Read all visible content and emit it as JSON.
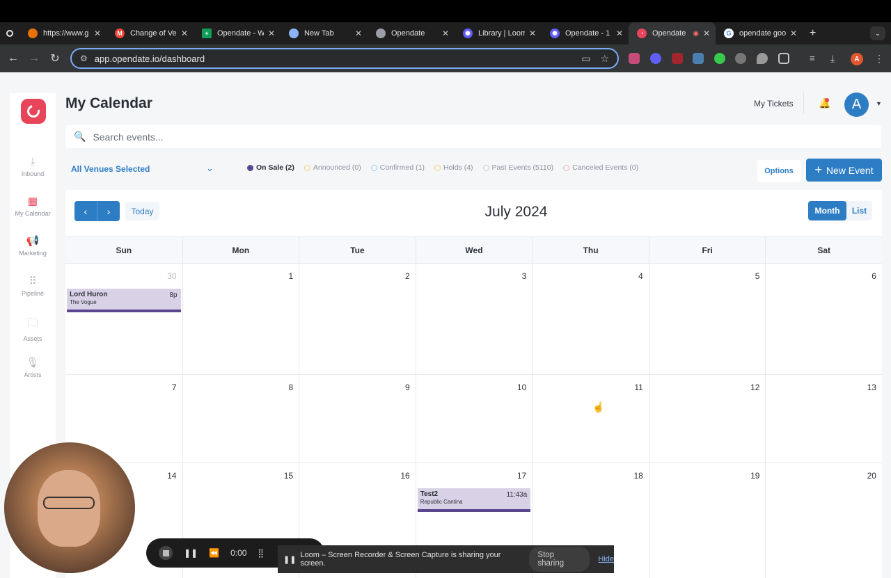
{
  "browser": {
    "tabs": [
      {
        "title": "https://www.g",
        "favicon_color": "#e8710a"
      },
      {
        "title": "Change of Ve",
        "favicon_color": "#ea4335",
        "icon": "gmail-icon"
      },
      {
        "title": "Opendate - W",
        "favicon_color": "#0f9d58",
        "icon": "sheets-icon"
      },
      {
        "title": "New Tab",
        "favicon_color": "#8ab4f8",
        "icon": "chrome-icon"
      },
      {
        "title": "Opendate",
        "favicon_color": "#9aa0a6",
        "icon": "globe-icon"
      },
      {
        "title": "Library | Loom",
        "favicon_color": "#625df5",
        "icon": "loom-icon"
      },
      {
        "title": "Opendate - 1",
        "favicon_color": "#625df5",
        "icon": "loom-icon"
      },
      {
        "title": "Opendate",
        "favicon_color": "#e8445a",
        "icon": "opendate-icon",
        "active": true
      },
      {
        "title": "opendate goo",
        "favicon_color": "#4285f4",
        "icon": "google-icon"
      }
    ],
    "new_tab": "+",
    "url": "app.opendate.io/dashboard",
    "profile_initial": "A"
  },
  "sidebar": {
    "items": [
      {
        "label": "Inbound",
        "icon": "inbox-download-icon"
      },
      {
        "label": "My Calendar",
        "icon": "calendar-icon",
        "active": true
      },
      {
        "label": "Marketing",
        "icon": "megaphone-icon"
      },
      {
        "label": "Pipeline",
        "icon": "pipeline-icon"
      },
      {
        "label": "Assets",
        "icon": "folder-icon"
      },
      {
        "label": "Artists",
        "icon": "microphone-icon"
      }
    ]
  },
  "header": {
    "title": "My Calendar",
    "my_tickets": "My Tickets",
    "avatar_initial": "A"
  },
  "search": {
    "placeholder": "Search events..."
  },
  "filters": {
    "venues": "All Venues Selected",
    "statuses": [
      {
        "label": "On Sale (2)",
        "color": "#5b4690",
        "on": true
      },
      {
        "label": "Announced (0)",
        "color": "#f2e08a"
      },
      {
        "label": "Confirmed (1)",
        "color": "#b9d8f0"
      },
      {
        "label": "Holds (4)",
        "color": "#f2e08a"
      },
      {
        "label": "Past Events (5110)",
        "color": "#d6d6d6"
      },
      {
        "label": "Canceled Events (0)",
        "color": "#f2c4c4"
      }
    ],
    "options": "Options",
    "new_event": "New Event"
  },
  "calendar": {
    "today": "Today",
    "month_title": "July 2024",
    "view_month": "Month",
    "view_list": "List",
    "weekdays": [
      "Sun",
      "Mon",
      "Tue",
      "Wed",
      "Thu",
      "Fri",
      "Sat"
    ],
    "weeks": [
      [
        "30",
        "1",
        "2",
        "3",
        "4",
        "5",
        "6"
      ],
      [
        "7",
        "8",
        "9",
        "10",
        "11",
        "12",
        "13"
      ],
      [
        "14",
        "15",
        "16",
        "17",
        "18",
        "19",
        "20"
      ]
    ],
    "events": [
      {
        "name": "Lord Huron",
        "time": "8p",
        "venue": "The Vogue"
      },
      {
        "name": "Test2",
        "time": "11:43a",
        "venue": "Republic Cantina"
      }
    ]
  },
  "loom": {
    "timer": "0:00",
    "sharing_text": "Loom – Screen Recorder & Screen Capture is sharing your screen.",
    "stop_sharing": "Stop sharing",
    "hide": "Hide"
  }
}
